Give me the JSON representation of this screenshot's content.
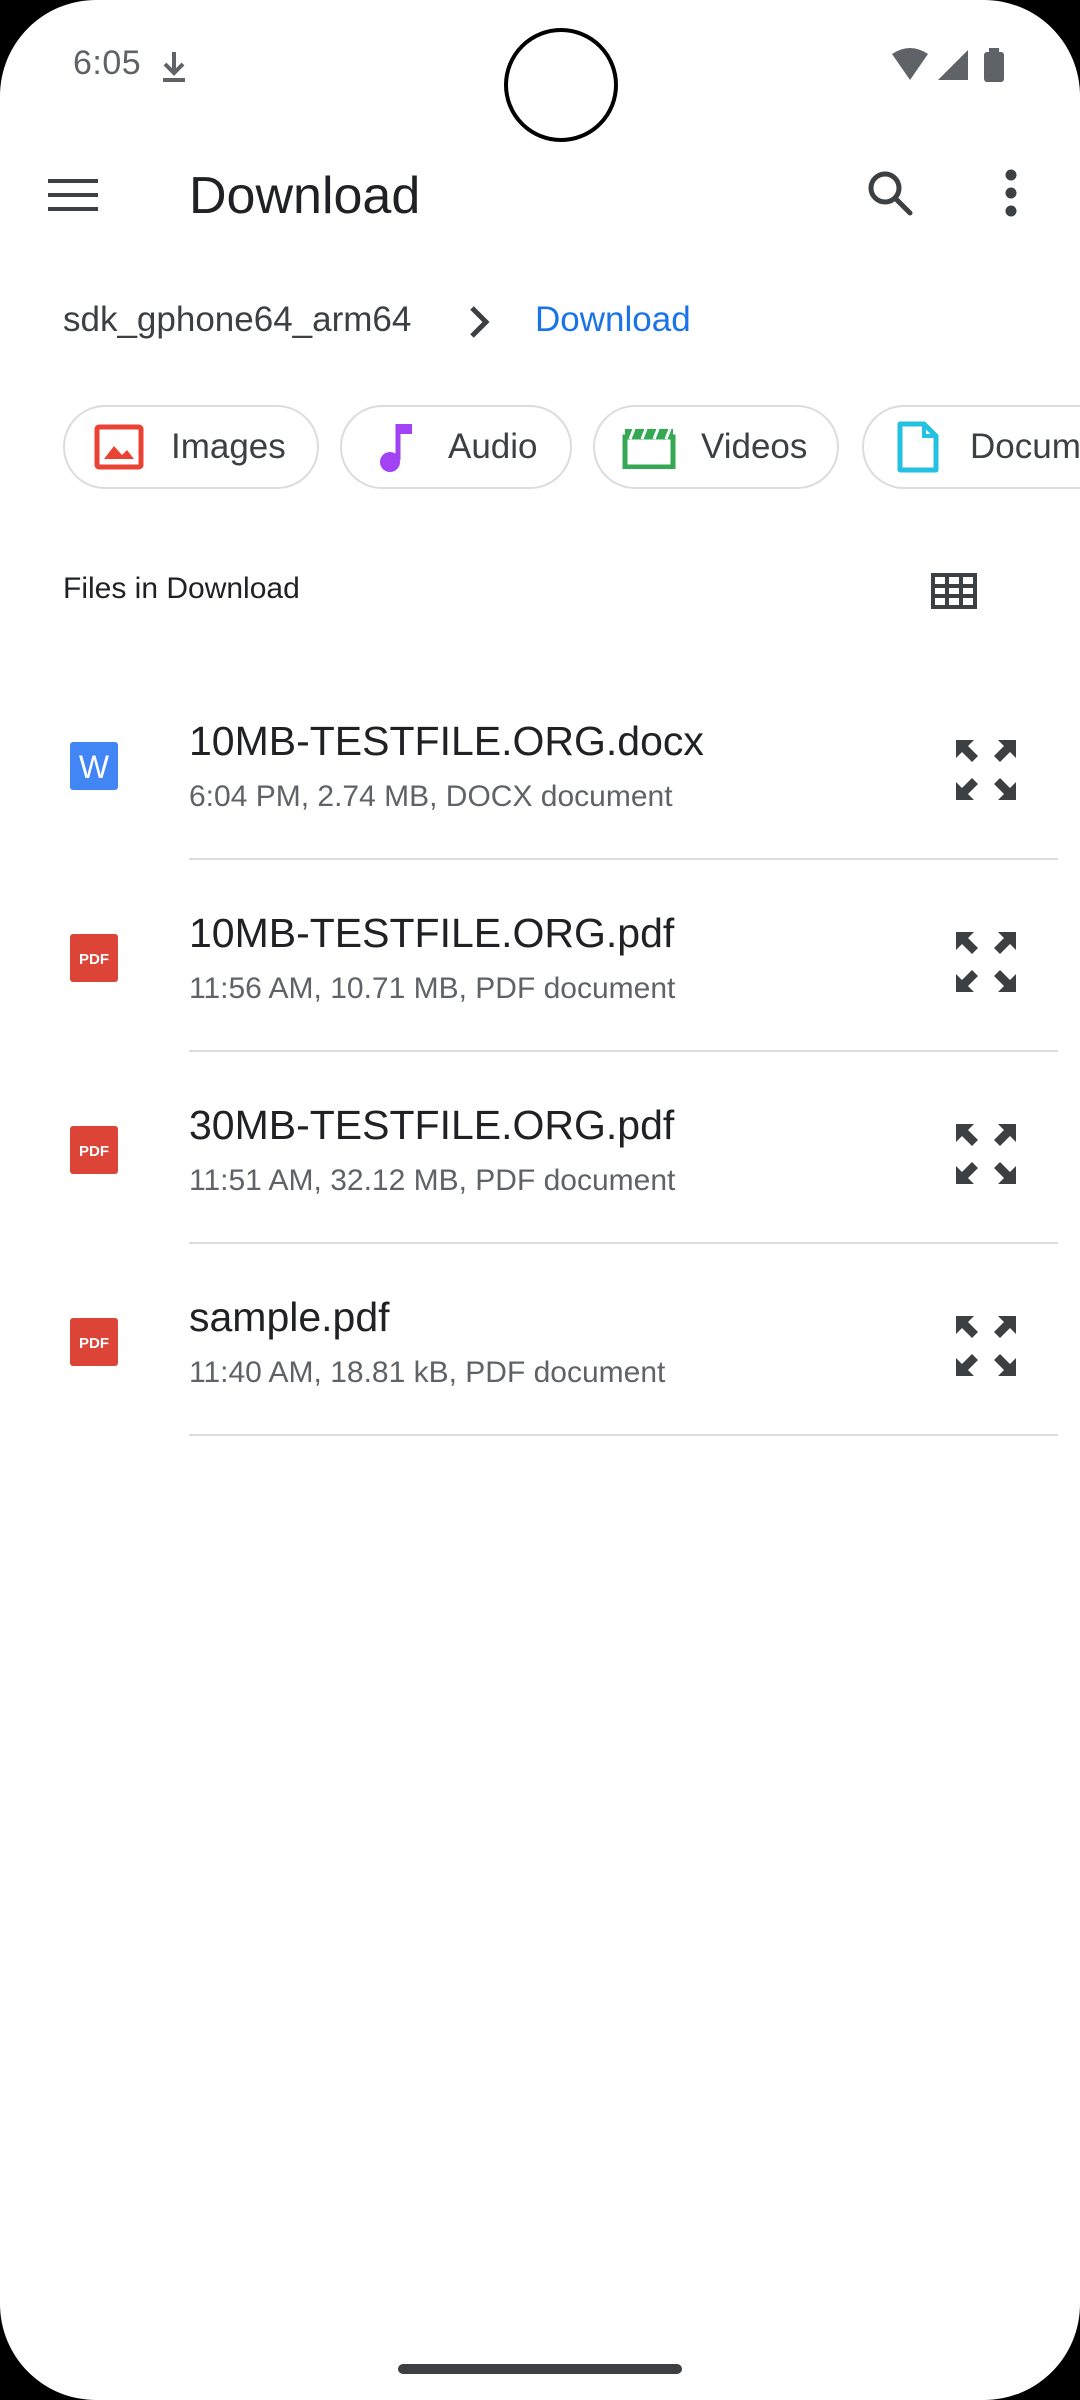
{
  "status_bar": {
    "time": "6:05"
  },
  "toolbar": {
    "title": "Download"
  },
  "breadcrumb": {
    "root": "sdk_gphone64_arm64",
    "current": "Download"
  },
  "chips": [
    {
      "label": "Images",
      "icon": "image-icon",
      "color": "#ea4335"
    },
    {
      "label": "Audio",
      "icon": "music-note-icon",
      "color": "#a142f4"
    },
    {
      "label": "Videos",
      "icon": "movie-icon",
      "color": "#34a853"
    },
    {
      "label": "Docum",
      "icon": "document-icon",
      "color": "#24c1e0"
    }
  ],
  "section": {
    "title": "Files in Download"
  },
  "files": [
    {
      "name": "10MB-TESTFILE.ORG.docx",
      "meta": "6:04 PM, 2.74 MB, DOCX document",
      "type": "docx",
      "icon_text": "W",
      "icon_color": "#4285f4"
    },
    {
      "name": "10MB-TESTFILE.ORG.pdf",
      "meta": "11:56 AM, 10.71 MB, PDF document",
      "type": "pdf",
      "icon_text": "PDF",
      "icon_color": "#db4437"
    },
    {
      "name": "30MB-TESTFILE.ORG.pdf",
      "meta": "11:51 AM, 32.12 MB, PDF document",
      "type": "pdf",
      "icon_text": "PDF",
      "icon_color": "#db4437"
    },
    {
      "name": "sample.pdf",
      "meta": "11:40 AM, 18.81 kB, PDF document",
      "type": "pdf",
      "icon_text": "PDF",
      "icon_color": "#db4437"
    }
  ]
}
